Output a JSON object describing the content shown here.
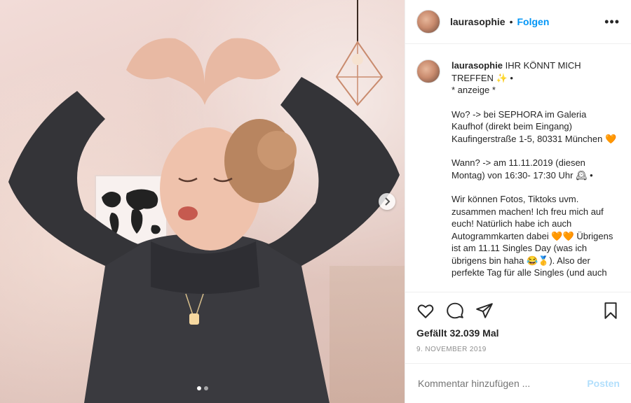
{
  "header": {
    "username": "laurasophie",
    "separator": "•",
    "follow_label": "Folgen",
    "more_label": "•••"
  },
  "caption": {
    "username": "laurasophie",
    "lines": [
      "IHR KÖNNT MICH TREFFEN ✨ •",
      "* anzeige *",
      "",
      "Wo? -> bei SEPHORA im Galeria Kaufhof (direkt beim Eingang) Kaufingerstraße 1-5, 80331 München 🧡",
      "",
      "Wann? -> am 11.11.2019 (diesen Montag) von 16:30- 17:30 Uhr 🕰 •",
      "",
      "Wir können Fotos, Tiktoks uvm. zusammen machen! Ich freu mich auf euch! Natürlich habe ich auch Autogrammkarten dabei 🧡🧡 Übrigens ist am 11.11 Singles Day (was ich übrigens bin haha 😂🥇). Also der perfekte Tag für alle Singles (und auch"
    ]
  },
  "icons": {
    "like": "heart-icon",
    "comment": "comment-icon",
    "share": "share-icon",
    "save": "bookmark-icon",
    "next": "chevron-right-icon"
  },
  "likes_text": "Gefällt 32.039 Mal",
  "date_text": "9. November 2019",
  "comment_box": {
    "placeholder": "Kommentar hinzufügen ...",
    "post_label": "Posten"
  },
  "carousel": {
    "slides": 2,
    "active": 1
  },
  "colors": {
    "accent": "#0095f6",
    "post_disabled": "#b2dffc",
    "muted": "#8e8e8e"
  }
}
